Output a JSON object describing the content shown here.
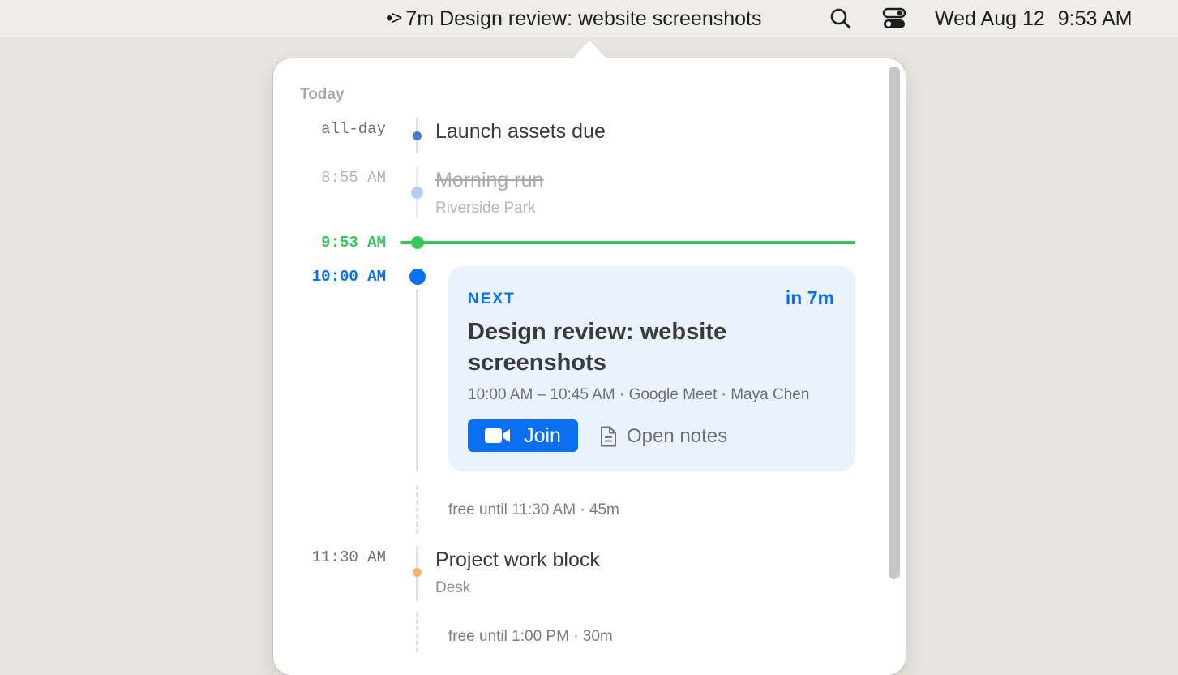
{
  "menubar": {
    "app_glyph": "•>",
    "app_text": "7m Design review: website screenshots",
    "search_icon": "search-icon",
    "control_icon": "control-center-icon",
    "date": "Wed Aug 12",
    "time": "9:53 AM"
  },
  "agenda": {
    "section_title": "Today",
    "events": [
      {
        "time": "all-day",
        "title": "Launch assets due",
        "color": "#4a7bd9"
      },
      {
        "time": "8:55 AM",
        "title": "Morning run",
        "subtitle": "Riverside Park",
        "color": "#b9cbf5",
        "completed": true
      },
      {
        "time": "11:30 AM",
        "title": "Project work block",
        "subtitle": "Desk",
        "color": "#f4b46a"
      }
    ],
    "now": {
      "time": "9:53 AM",
      "color": "#34c759"
    },
    "next": {
      "time": "10:00 AM",
      "label": "NEXT",
      "countdown": "in 7m",
      "title": "Design review: website screenshots",
      "details": "10:00 AM – 10:45 AM · Google Meet · Maya Chen",
      "join_label": "Join",
      "notes_label": "Open notes",
      "color": "#0a6ff0"
    },
    "gaps": [
      {
        "text": "free until 11:30 AM · 45m"
      },
      {
        "text": "free until 1:00 PM · 30m"
      }
    ]
  }
}
